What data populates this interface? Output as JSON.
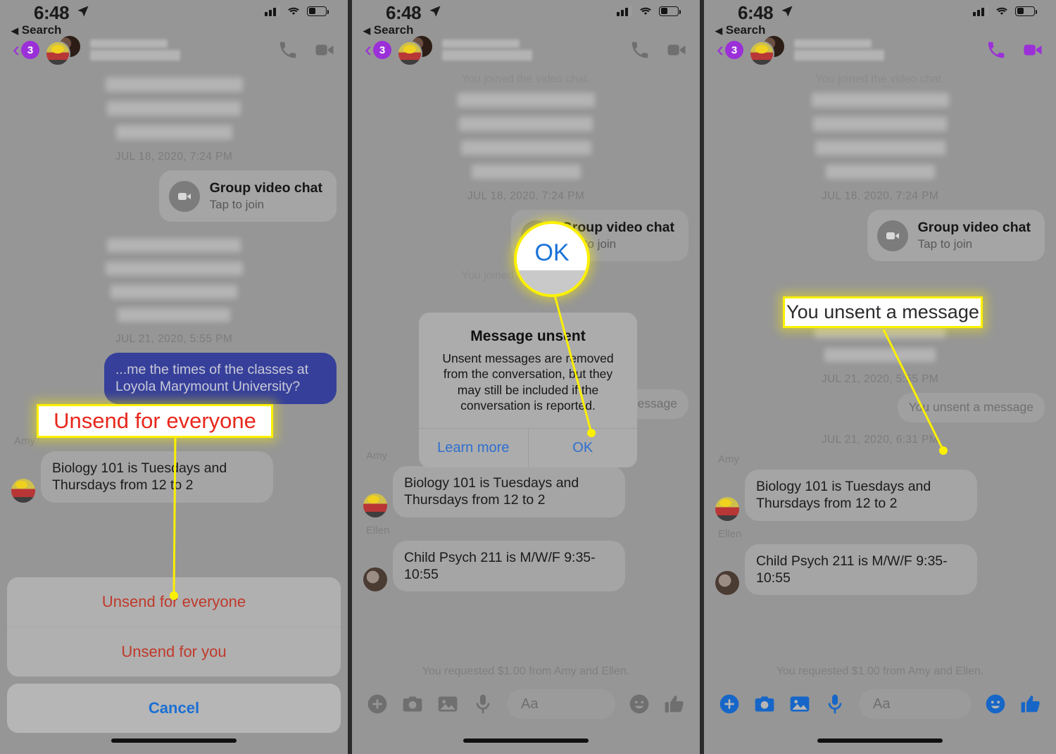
{
  "meta": {
    "panel_count": 3,
    "bg": "#2b2b2b",
    "screen_bg": "#969696",
    "accent_yellow": "#fbf000"
  },
  "status_bar": {
    "time": "6:48",
    "back_label": "Search",
    "back_caret": "◀",
    "location_icon": "location-arrow-icon",
    "signal_icon": "cellular-signal-icon",
    "wifi_icon": "wifi-icon",
    "battery_icon": "battery-icon"
  },
  "nav": {
    "back_chevron": "‹",
    "unread_badge": "3",
    "contact_name_redacted": "",
    "call_icon": "phone-icon",
    "video_icon": "video-camera-icon",
    "color_active": "#9b30d9",
    "color_dim": "#6f6f6f"
  },
  "thread": {
    "joined_notice": "You joined the video chat.",
    "timestamps": {
      "t1": "JUL 18, 2020, 7:24 PM",
      "t2": "JUL 21, 2020, 5:55 PM",
      "t3": "JUL 21, 2020, 6:31 PM"
    },
    "video_card": {
      "title": "Group video chat",
      "subtitle": "Tap to join",
      "icon": "video-camera-icon"
    },
    "outgoing_bubble": {
      "text": "...me the times of the classes at Loyola Marymount University?",
      "color": "#36409a"
    },
    "unsent_notice": "You unsent a message",
    "messages": [
      {
        "sender": "Amy",
        "text": "Biology 101 is Tuesdays and Thursdays from 12 to 2",
        "avatar": "amy-avatar"
      },
      {
        "sender": "Ellen",
        "text": "Child Psych 211 is M/W/F 9:35-10:55",
        "avatar": "ellen-avatar"
      }
    ],
    "payment_notice": "You requested $1.00 from Amy and Ellen."
  },
  "action_sheet": {
    "unsend_everyone": "Unsend for everyone",
    "unsend_you": "Unsend for you",
    "cancel": "Cancel",
    "destructive_color": "#c0392b",
    "cancel_color": "#1a6fd4"
  },
  "alert": {
    "title": "Message unsent",
    "message": "Unsent messages are removed from the conversation, but they may still be included if the conversation is reported.",
    "learn_more": "Learn more",
    "ok": "OK",
    "link_color": "#2f6fd0"
  },
  "composer": {
    "placeholder": "Aa",
    "icons": [
      "plus-circle-icon",
      "camera-icon",
      "photo-icon",
      "microphone-icon",
      "emoji-icon",
      "thumbs-up-icon"
    ],
    "active_color": "#1666c8",
    "dim_color": "#6f6f6f"
  },
  "annotations": {
    "panel1_callout": "Unsend for everyone",
    "panel2_magnifier": "OK",
    "panel3_callout": "You unsent a message"
  }
}
